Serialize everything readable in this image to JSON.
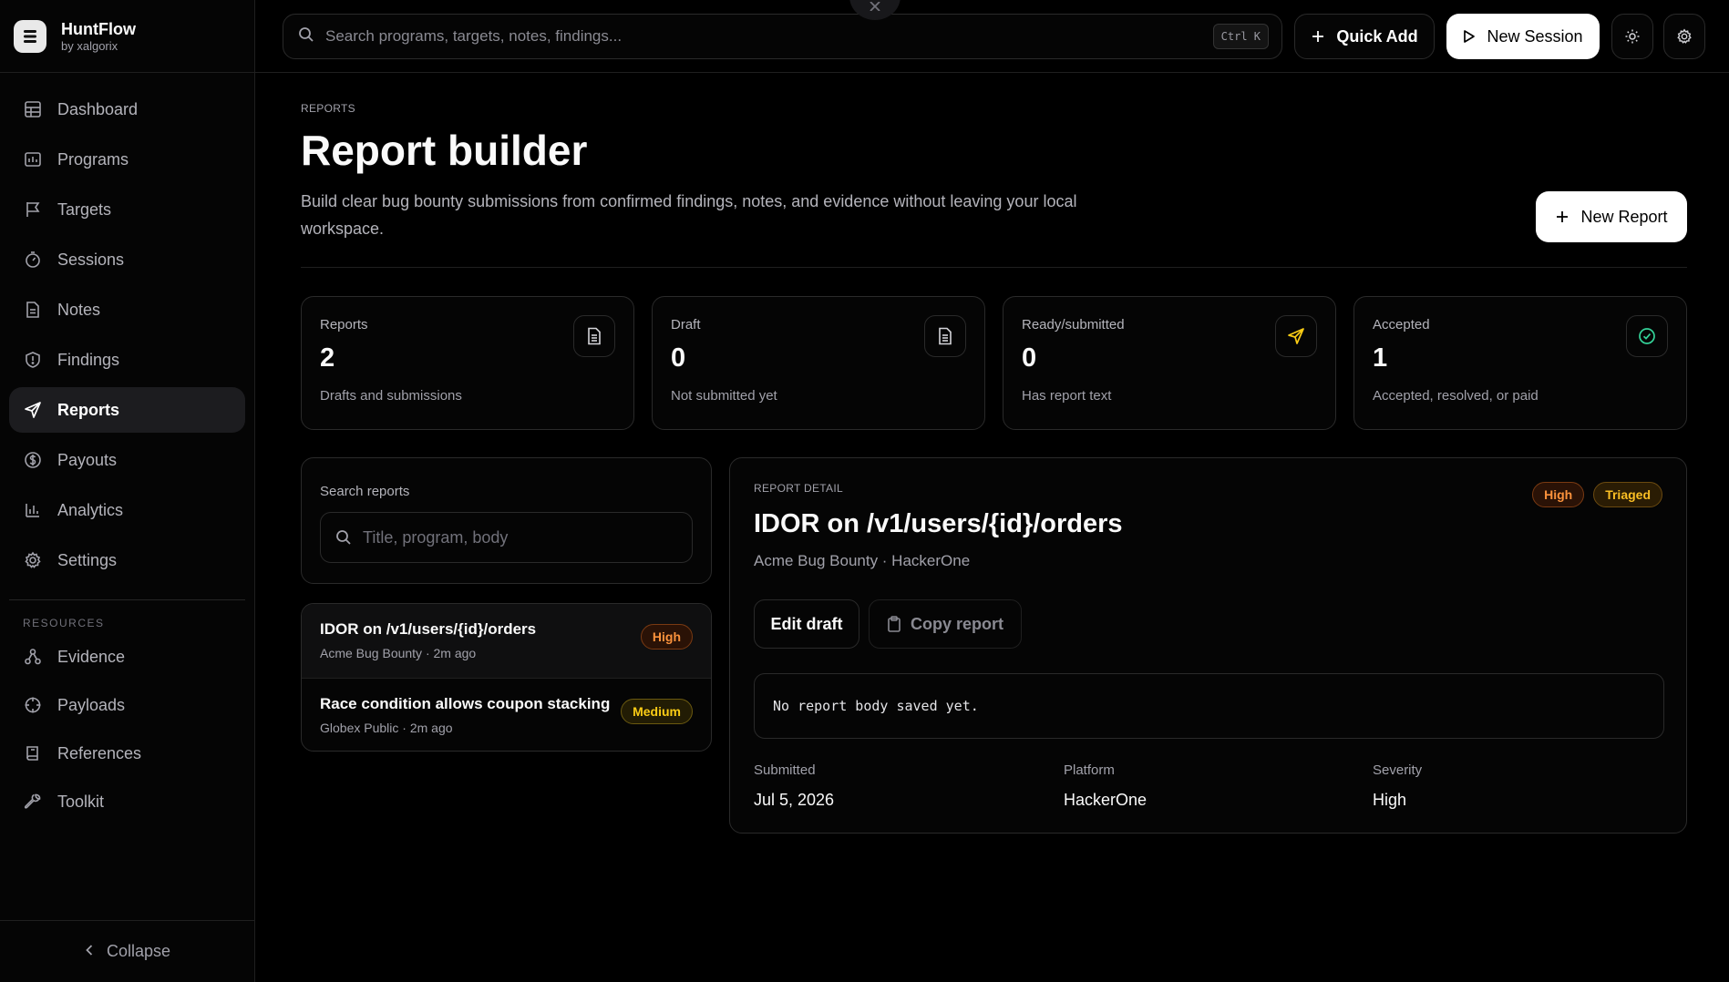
{
  "brand": {
    "name": "HuntFlow",
    "by": "by xalgorix"
  },
  "nav": [
    {
      "label": "Dashboard",
      "icon": "grid-icon"
    },
    {
      "label": "Programs",
      "icon": "chart-box-icon"
    },
    {
      "label": "Targets",
      "icon": "flag-icon"
    },
    {
      "label": "Sessions",
      "icon": "timer-icon"
    },
    {
      "label": "Notes",
      "icon": "file-icon"
    },
    {
      "label": "Findings",
      "icon": "shield-icon"
    },
    {
      "label": "Reports",
      "icon": "send-icon",
      "active": true
    },
    {
      "label": "Payouts",
      "icon": "dollar-circle-icon"
    },
    {
      "label": "Analytics",
      "icon": "bar-chart-icon"
    },
    {
      "label": "Settings",
      "icon": "gear-icon"
    }
  ],
  "resources_label": "RESOURCES",
  "resources": [
    {
      "label": "Evidence",
      "icon": "nodes-icon"
    },
    {
      "label": "Payloads",
      "icon": "crosshair-icon"
    },
    {
      "label": "References",
      "icon": "book-icon"
    },
    {
      "label": "Toolkit",
      "icon": "wrench-icon"
    }
  ],
  "collapse_label": "Collapse",
  "topbar": {
    "search_placeholder": "Search programs, targets, notes, findings...",
    "shortcut": "Ctrl K",
    "quick_add": "Quick Add",
    "new_session": "New Session"
  },
  "page": {
    "eyebrow": "REPORTS",
    "title": "Report builder",
    "description": "Build clear bug bounty submissions from confirmed findings, notes, and evidence without leaving your local workspace.",
    "new_report": "New Report"
  },
  "stats": [
    {
      "label": "Reports",
      "value": "2",
      "sub": "Drafts and submissions",
      "icon": "document-icon",
      "color": "#d4d4d8"
    },
    {
      "label": "Draft",
      "value": "0",
      "sub": "Not submitted yet",
      "icon": "document-icon",
      "color": "#d4d4d8"
    },
    {
      "label": "Ready/submitted",
      "value": "0",
      "sub": "Has report text",
      "icon": "send-icon",
      "color": "#facc15"
    },
    {
      "label": "Accepted",
      "value": "1",
      "sub": "Accepted, resolved, or paid",
      "icon": "check-circle-icon",
      "color": "#34d399"
    }
  ],
  "search_reports": {
    "label": "Search reports",
    "placeholder": "Title, program, body"
  },
  "reports": [
    {
      "title": "IDOR on /v1/users/{id}/orders",
      "meta": "Acme Bug Bounty · 2m ago",
      "severity": "High"
    },
    {
      "title": "Race condition allows coupon stacking",
      "meta": "Globex Public · 2m ago",
      "severity": "Medium"
    }
  ],
  "detail": {
    "eyebrow": "REPORT DETAIL",
    "title": "IDOR on /v1/users/{id}/orders",
    "subtitle": "Acme Bug Bounty · HackerOne",
    "badges": [
      "High",
      "Triaged"
    ],
    "edit_label": "Edit draft",
    "copy_label": "Copy report",
    "body": "No report body saved yet.",
    "meta": [
      {
        "label": "Submitted",
        "value": "Jul 5, 2026"
      },
      {
        "label": "Platform",
        "value": "HackerOne"
      },
      {
        "label": "Severity",
        "value": "High"
      }
    ]
  },
  "colors": {
    "accent_high": "#fb923c",
    "accent_medium": "#facc15",
    "accent_triaged": "#fbbf24",
    "accepted": "#34d399"
  }
}
